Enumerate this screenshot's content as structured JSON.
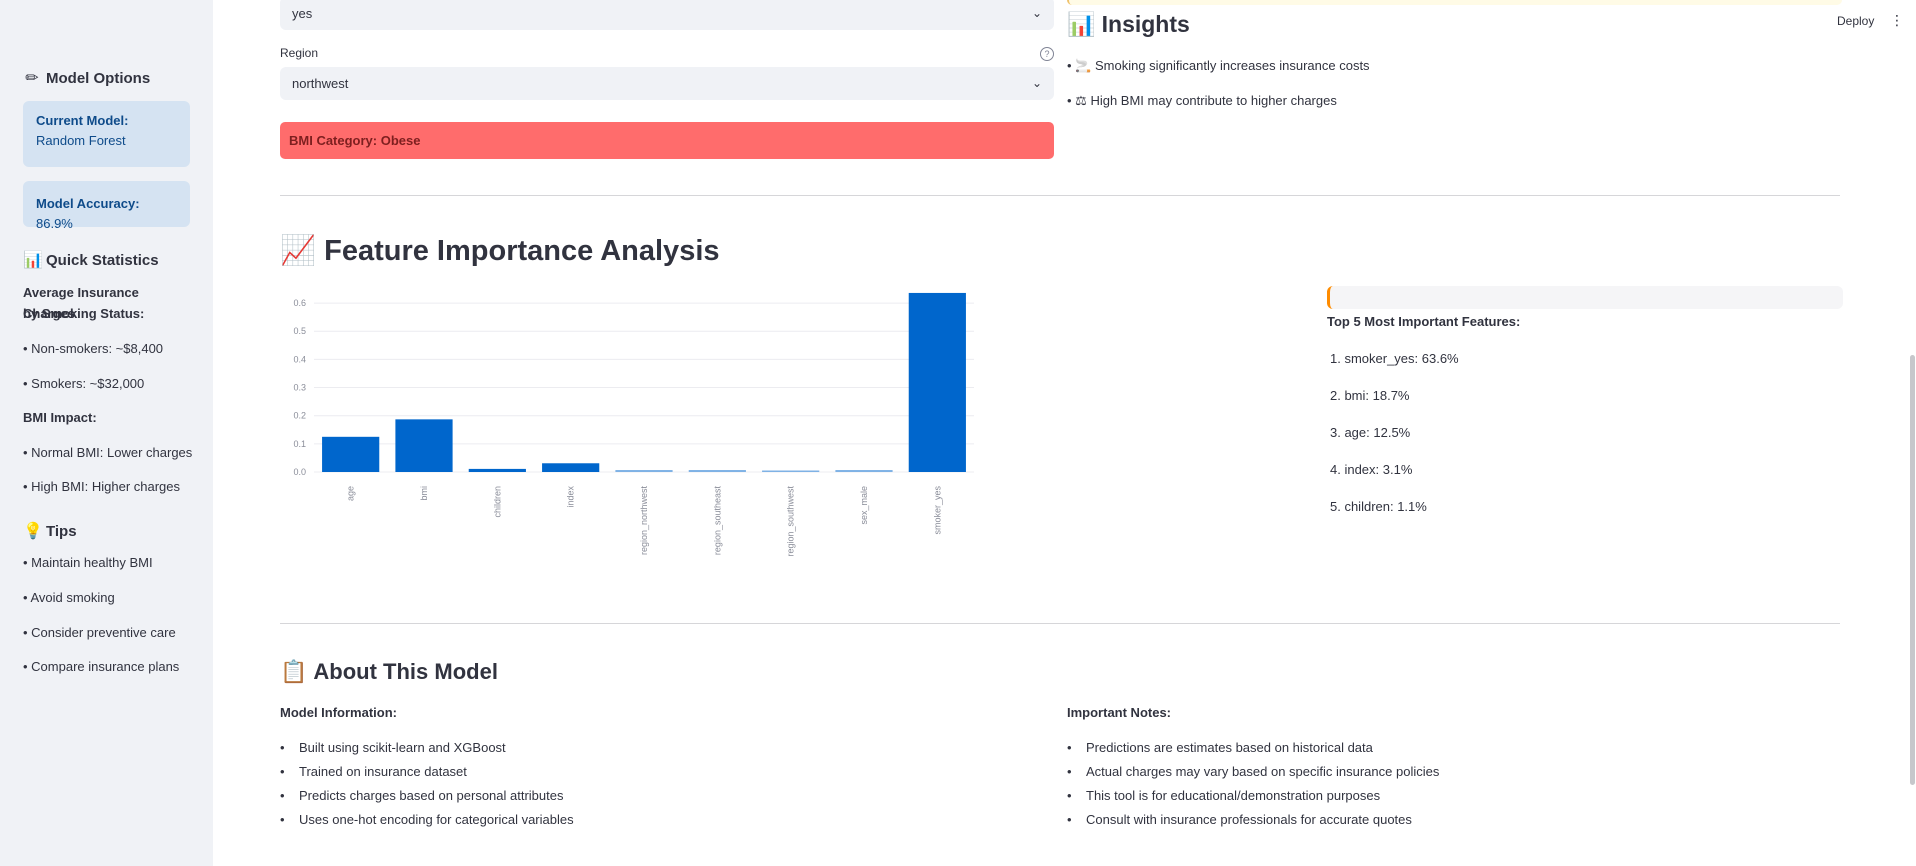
{
  "sidebar": {
    "model_options": {
      "icon": "pencil-icon",
      "glyph": "✏",
      "title": "Model Options"
    },
    "current_model": {
      "label": "Current Model:",
      "value": "Random Forest"
    },
    "model_accuracy": {
      "label": "Model Accuracy:",
      "value": "86.9%"
    },
    "quick_stats": {
      "icon": "bar-chart-icon",
      "glyph": "📊",
      "title": "Quick Statistics"
    },
    "avg_heading_1": "Average Insurance Charges",
    "avg_heading_2": "by Smoking Status:",
    "non_smokers": "• Non-smokers: ~$8,400",
    "smokers": "• Smokers: ~$32,000",
    "bmi_impact": "BMI Impact:",
    "normal_bmi": "• Normal BMI: Lower charges",
    "high_bmi": "• High BMI: Higher charges",
    "tips": {
      "icon": "lightbulb-icon",
      "glyph": "💡",
      "title": "Tips"
    },
    "tip_items": [
      "• Maintain healthy BMI",
      "• Avoid smoking",
      "• Consider preventive care",
      "• Compare insurance plans"
    ]
  },
  "form": {
    "smoker_value": "yes",
    "region_label": "Region",
    "region_value": "northwest",
    "help_glyph": "?",
    "bmi_category": "BMI Category: Obese"
  },
  "header": {
    "deploy": "Deploy",
    "menu_glyph": "⋮"
  },
  "insights": {
    "glyph": "📊",
    "title": "Insights",
    "items": [
      {
        "glyph": "🚬",
        "text": "Smoking significantly increases insurance costs"
      },
      {
        "glyph": "⚖",
        "text": "High BMI may contribute to higher charges"
      }
    ]
  },
  "feature_section": {
    "glyph": "📈",
    "title": "Feature Importance Analysis"
  },
  "chart_data": {
    "type": "bar",
    "categories": [
      "age",
      "bmi",
      "children",
      "index",
      "region_northwest",
      "region_southeast",
      "region_southwest",
      "sex_male",
      "smoker_yes"
    ],
    "values": [
      0.125,
      0.187,
      0.011,
      0.031,
      0.007,
      0.007,
      0.005,
      0.007,
      0.636
    ],
    "ylim": [
      0,
      0.65
    ],
    "yticks": [
      "0.0",
      "0.1",
      "0.2",
      "0.3",
      "0.4",
      "0.5",
      "0.6"
    ],
    "bar_colors": {
      "main": "#0066cc",
      "faint": "#7fb2e5"
    },
    "grid": true,
    "title": "",
    "xlabel": "",
    "ylabel": ""
  },
  "top5": {
    "title": "Top 5 Most Important Features:",
    "items": [
      "1.  smoker_yes: 63.6%",
      "2.  bmi: 18.7%",
      "3.  age: 12.5%",
      "4.  index: 3.1%",
      "5.  children: 1.1%"
    ]
  },
  "about": {
    "glyph": "📋",
    "title": "About This Model",
    "model_info_title": "Model Information:",
    "model_info": [
      "Built using scikit-learn and XGBoost",
      "Trained on insurance dataset",
      "Predicts charges based on personal attributes",
      "Uses one-hot encoding for categorical variables"
    ],
    "notes_title": "Important Notes:",
    "notes": [
      "Predictions are estimates based on historical data",
      "Actual charges may vary based on specific insurance policies",
      "This tool is for educational/demonstration purposes",
      "Consult with insurance professionals for accurate quotes"
    ]
  }
}
